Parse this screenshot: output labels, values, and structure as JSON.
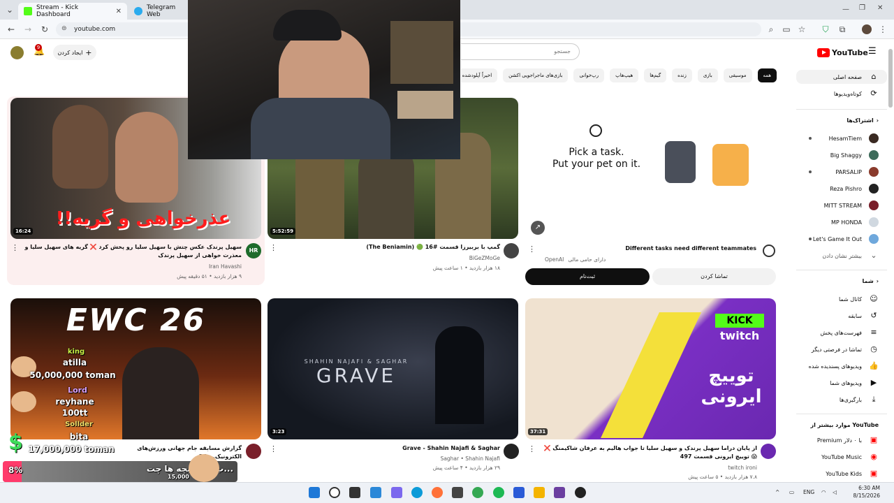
{
  "browser": {
    "tabs": [
      {
        "title": "Stream - Kick Dashboard",
        "active": true
      },
      {
        "title": "Telegram Web",
        "active": false
      }
    ],
    "url": "youtube.com"
  },
  "header": {
    "logo_text": "YouTube",
    "search_placeholder": "جستجو",
    "create_label": "ایجاد کردن",
    "notification_count": "9"
  },
  "chips": [
    "همه",
    "موسیقی",
    "بازی",
    "زنده",
    "گیم‌ها",
    "هیپ‌هاپ",
    "رپ‌خوانی",
    "بازی‌های ماجراجویی اکشن",
    "اخیراً آپلودشده"
  ],
  "sidebar": {
    "main": [
      {
        "label": "صفحه اصلی",
        "icon": "home-icon"
      },
      {
        "label": "کوتاه‌ویدیوها",
        "icon": "shorts-icon"
      }
    ],
    "subscriptions_header": "اشتراک‌ها",
    "subscriptions": [
      {
        "label": "HesamTiem",
        "color": "#3a2a22",
        "live": true
      },
      {
        "label": "Big Shaggy",
        "color": "#3d6b5a",
        "live": false
      },
      {
        "label": "PARSALIP",
        "color": "#8a3b2c",
        "live": true
      },
      {
        "label": "Reza Pishro",
        "color": "#222222",
        "live": false
      },
      {
        "label": "MITT STREAM",
        "color": "#7a1f2a",
        "live": false
      },
      {
        "label": "MP HONDA",
        "color": "#d0d8e0",
        "live": false
      },
      {
        "label": "Let's Game It Out",
        "color": "#6fa8dc",
        "live": true
      }
    ],
    "show_more": "بیشتر نشان دادن",
    "you_header": "شما",
    "you": [
      {
        "label": "کانال شما",
        "icon": "user-icon"
      },
      {
        "label": "سابقه",
        "icon": "history-icon"
      },
      {
        "label": "فهرست‌های پخش",
        "icon": "playlist-icon"
      },
      {
        "label": "تماشا در فرصتی دیگر",
        "icon": "clock-icon"
      },
      {
        "label": "ویدیوهای پسندیده شده",
        "icon": "like-icon"
      },
      {
        "label": "ویدیوهای شما",
        "icon": "play-icon"
      },
      {
        "label": "بارگیری‌ها",
        "icon": "download-icon"
      }
    ],
    "explore_header": "موارد بیشتر از YouTube",
    "explore": [
      {
        "label": "Premium با ۰ دلار",
        "icon": "yt-premium-icon"
      },
      {
        "label": "YouTube Music",
        "icon": "yt-music-icon"
      },
      {
        "label": "YouTube Kids",
        "icon": "yt-kids-icon"
      }
    ]
  },
  "videos": [
    {
      "title": "سهیل پرندک عکس چتش با سهیل سلیا رو پخش کرد ❌ گریه های سهیل سلیا و معذرت خواهی از سهیل پرندک",
      "channel": "Iran Havashi",
      "meta": "۹ هزار بازدید • ۵۱ دقیقه پیش",
      "duration": "16:24",
      "thumb_text": "عذرخواهی و گریه!!",
      "avatar_text": "HR"
    },
    {
      "title": "گمپ با بربیرزا قسمت #16 🟢 (The Beniamin)",
      "channel": "BiGeZMoGe",
      "meta": "۱۸ هزار بازدید • ۱ ساعت پیش",
      "duration": "5:52:59"
    },
    {
      "title": "گزارش مسابقه جام جهانی ورزش‌های الکترونیک... 26",
      "channel": "",
      "meta": "",
      "duration": "",
      "thumb_text": "EWC 26"
    },
    {
      "title": "Grave - Shahin Najafi & Saghar",
      "channel": "Saghar • Shahin Najafi",
      "meta": "۲۹ هزار بازدید • ۴ ساعت پیش",
      "duration": "3:23",
      "thumb_text": "GRAVE",
      "thumb_sub": "SHAHIN NAJAFI & SAGHAR"
    },
    {
      "title": "از پایان دراما سهیل پرندک و سهیل سلیا تا جواب هالیم به عرفان شاکیمنگ ❌ 😱 توییچ ایرونی قسمت 497",
      "channel": "twitch ironi",
      "meta": "۷.۸ هزار بازدید • ۵ ساعت پیش",
      "duration": "37:31",
      "thumb_text": "توییچ ایرونی",
      "thumb_kick": "KICK",
      "thumb_twitch": "twitch"
    }
  ],
  "ad": {
    "headline1": "Pick a task.",
    "headline2": "Put your pet on it.",
    "title": "Different tasks need different teammates",
    "sponsor": "دارای حامی مالی",
    "advertiser": "OpenAI",
    "primary_button": "ثبت‌نام",
    "secondary_button": "تماشا کردن"
  },
  "overlay": {
    "donations": [
      {
        "rank": "king",
        "name": "atilla",
        "amount": "50,000,000 toman"
      },
      {
        "rank": "Lord",
        "name": "reyhane",
        "amount": "100tt"
      },
      {
        "rank": "Sollder",
        "name": "bita",
        "amount": "17,000,000 toman"
      }
    ],
    "goal_percent": "8%",
    "goal_text": "...ب برای بچه ها چت",
    "goal_amount": "15,000"
  },
  "taskbar": {
    "lang": "ENG",
    "time": "6:30 AM",
    "date": "8/15/2026"
  }
}
